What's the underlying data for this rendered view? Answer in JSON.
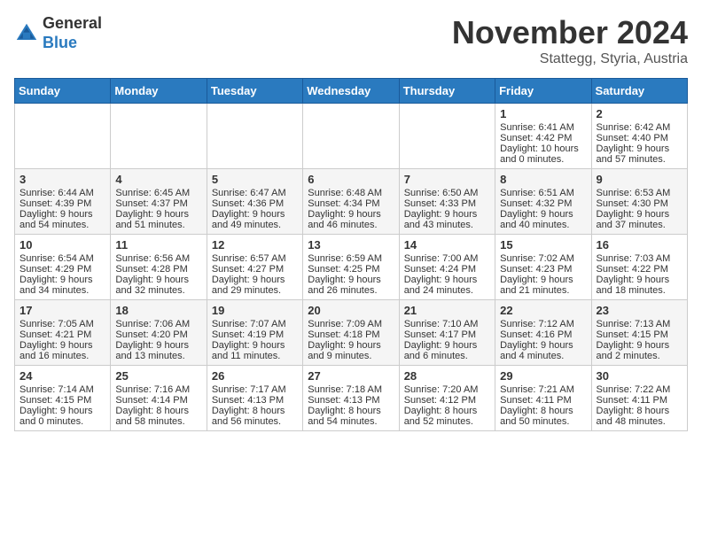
{
  "header": {
    "logo_line1": "General",
    "logo_line2": "Blue",
    "month": "November 2024",
    "location": "Stattegg, Styria, Austria"
  },
  "days_of_week": [
    "Sunday",
    "Monday",
    "Tuesday",
    "Wednesday",
    "Thursday",
    "Friday",
    "Saturday"
  ],
  "weeks": [
    [
      {
        "day": "",
        "info": ""
      },
      {
        "day": "",
        "info": ""
      },
      {
        "day": "",
        "info": ""
      },
      {
        "day": "",
        "info": ""
      },
      {
        "day": "",
        "info": ""
      },
      {
        "day": "1",
        "info": "Sunrise: 6:41 AM\nSunset: 4:42 PM\nDaylight: 10 hours\nand 0 minutes."
      },
      {
        "day": "2",
        "info": "Sunrise: 6:42 AM\nSunset: 4:40 PM\nDaylight: 9 hours\nand 57 minutes."
      }
    ],
    [
      {
        "day": "3",
        "info": "Sunrise: 6:44 AM\nSunset: 4:39 PM\nDaylight: 9 hours\nand 54 minutes."
      },
      {
        "day": "4",
        "info": "Sunrise: 6:45 AM\nSunset: 4:37 PM\nDaylight: 9 hours\nand 51 minutes."
      },
      {
        "day": "5",
        "info": "Sunrise: 6:47 AM\nSunset: 4:36 PM\nDaylight: 9 hours\nand 49 minutes."
      },
      {
        "day": "6",
        "info": "Sunrise: 6:48 AM\nSunset: 4:34 PM\nDaylight: 9 hours\nand 46 minutes."
      },
      {
        "day": "7",
        "info": "Sunrise: 6:50 AM\nSunset: 4:33 PM\nDaylight: 9 hours\nand 43 minutes."
      },
      {
        "day": "8",
        "info": "Sunrise: 6:51 AM\nSunset: 4:32 PM\nDaylight: 9 hours\nand 40 minutes."
      },
      {
        "day": "9",
        "info": "Sunrise: 6:53 AM\nSunset: 4:30 PM\nDaylight: 9 hours\nand 37 minutes."
      }
    ],
    [
      {
        "day": "10",
        "info": "Sunrise: 6:54 AM\nSunset: 4:29 PM\nDaylight: 9 hours\nand 34 minutes."
      },
      {
        "day": "11",
        "info": "Sunrise: 6:56 AM\nSunset: 4:28 PM\nDaylight: 9 hours\nand 32 minutes."
      },
      {
        "day": "12",
        "info": "Sunrise: 6:57 AM\nSunset: 4:27 PM\nDaylight: 9 hours\nand 29 minutes."
      },
      {
        "day": "13",
        "info": "Sunrise: 6:59 AM\nSunset: 4:25 PM\nDaylight: 9 hours\nand 26 minutes."
      },
      {
        "day": "14",
        "info": "Sunrise: 7:00 AM\nSunset: 4:24 PM\nDaylight: 9 hours\nand 24 minutes."
      },
      {
        "day": "15",
        "info": "Sunrise: 7:02 AM\nSunset: 4:23 PM\nDaylight: 9 hours\nand 21 minutes."
      },
      {
        "day": "16",
        "info": "Sunrise: 7:03 AM\nSunset: 4:22 PM\nDaylight: 9 hours\nand 18 minutes."
      }
    ],
    [
      {
        "day": "17",
        "info": "Sunrise: 7:05 AM\nSunset: 4:21 PM\nDaylight: 9 hours\nand 16 minutes."
      },
      {
        "day": "18",
        "info": "Sunrise: 7:06 AM\nSunset: 4:20 PM\nDaylight: 9 hours\nand 13 minutes."
      },
      {
        "day": "19",
        "info": "Sunrise: 7:07 AM\nSunset: 4:19 PM\nDaylight: 9 hours\nand 11 minutes."
      },
      {
        "day": "20",
        "info": "Sunrise: 7:09 AM\nSunset: 4:18 PM\nDaylight: 9 hours\nand 9 minutes."
      },
      {
        "day": "21",
        "info": "Sunrise: 7:10 AM\nSunset: 4:17 PM\nDaylight: 9 hours\nand 6 minutes."
      },
      {
        "day": "22",
        "info": "Sunrise: 7:12 AM\nSunset: 4:16 PM\nDaylight: 9 hours\nand 4 minutes."
      },
      {
        "day": "23",
        "info": "Sunrise: 7:13 AM\nSunset: 4:15 PM\nDaylight: 9 hours\nand 2 minutes."
      }
    ],
    [
      {
        "day": "24",
        "info": "Sunrise: 7:14 AM\nSunset: 4:15 PM\nDaylight: 9 hours\nand 0 minutes."
      },
      {
        "day": "25",
        "info": "Sunrise: 7:16 AM\nSunset: 4:14 PM\nDaylight: 8 hours\nand 58 minutes."
      },
      {
        "day": "26",
        "info": "Sunrise: 7:17 AM\nSunset: 4:13 PM\nDaylight: 8 hours\nand 56 minutes."
      },
      {
        "day": "27",
        "info": "Sunrise: 7:18 AM\nSunset: 4:13 PM\nDaylight: 8 hours\nand 54 minutes."
      },
      {
        "day": "28",
        "info": "Sunrise: 7:20 AM\nSunset: 4:12 PM\nDaylight: 8 hours\nand 52 minutes."
      },
      {
        "day": "29",
        "info": "Sunrise: 7:21 AM\nSunset: 4:11 PM\nDaylight: 8 hours\nand 50 minutes."
      },
      {
        "day": "30",
        "info": "Sunrise: 7:22 AM\nSunset: 4:11 PM\nDaylight: 8 hours\nand 48 minutes."
      }
    ]
  ]
}
